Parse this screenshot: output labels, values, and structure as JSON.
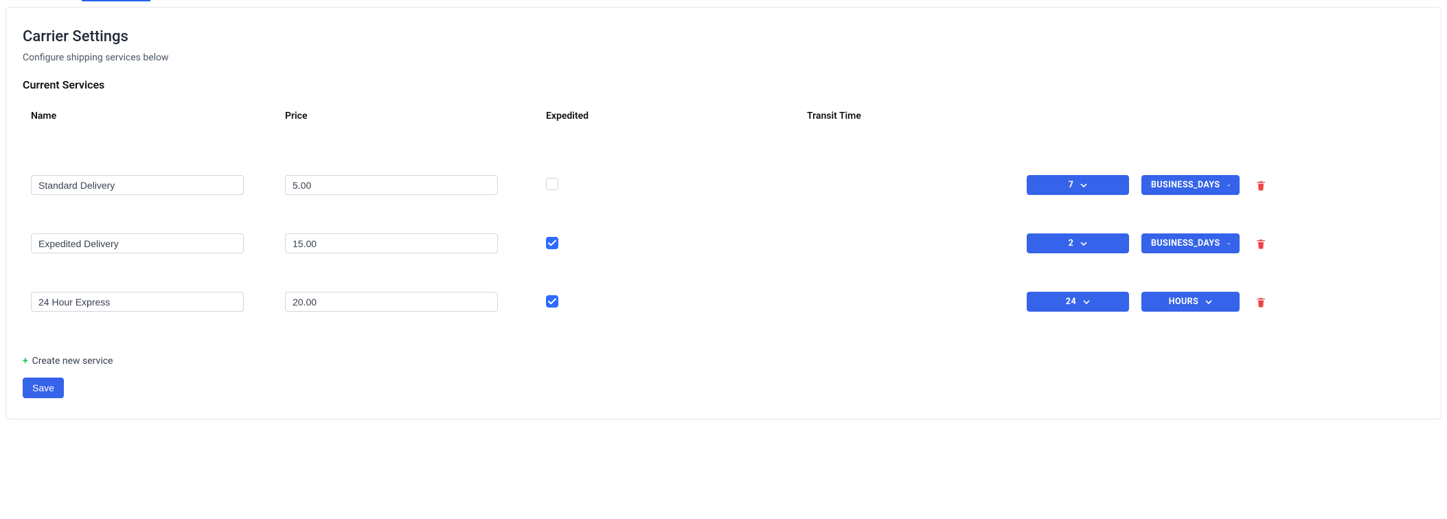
{
  "header": {
    "title": "Carrier Settings",
    "subtitle": "Configure shipping services below",
    "section": "Current Services"
  },
  "columns": {
    "name": "Name",
    "price": "Price",
    "expedited": "Expedited",
    "transit": "Transit Time"
  },
  "services": [
    {
      "name": "Standard Delivery",
      "price": "5.00",
      "expedited": false,
      "transit_value": "7",
      "transit_unit": "BUSINESS_DAYS"
    },
    {
      "name": "Expedited Delivery",
      "price": "15.00",
      "expedited": true,
      "transit_value": "2",
      "transit_unit": "BUSINESS_DAYS"
    },
    {
      "name": "24 Hour Express",
      "price": "20.00",
      "expedited": true,
      "transit_value": "24",
      "transit_unit": "HOURS"
    }
  ],
  "actions": {
    "create": "Create new service",
    "save": "Save"
  },
  "icons": {
    "chevron_down": "chevron-down-icon",
    "trash": "trash-icon",
    "plus": "plus-icon",
    "check": "check-icon"
  }
}
